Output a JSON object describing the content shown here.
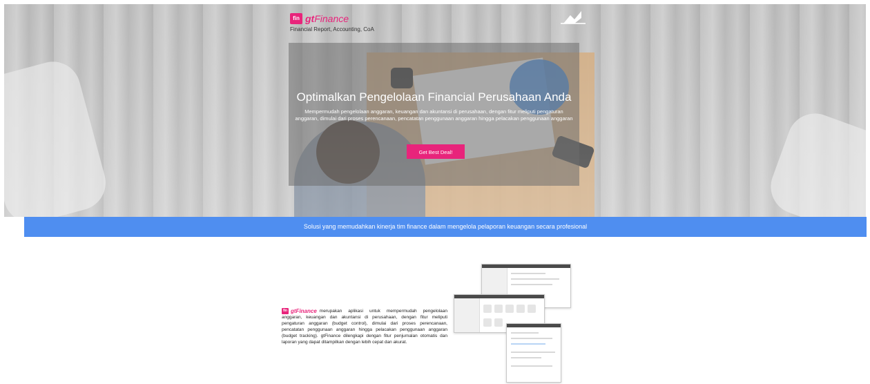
{
  "brand": {
    "logo_mark": "fin",
    "name_gt": "gt",
    "name_finance": "Finance",
    "tagline": "Financial Report, Accounting, CoA"
  },
  "hero": {
    "title": "Optimalkan Pengelolaan Financial Perusahaan Anda",
    "description": "Mempermudah pengelolaan anggaran, keuangan dan akuntansi di perusahaan, dengan fitur meliputi pengaturan anggaran, dimulai dari proses perencanaan, pencatatan penggunaan anggaran hingga pelacakan penggunaan anggaran",
    "cta_label": "Get Best Deal!"
  },
  "band": {
    "text": "Solusi yang memudahkan kinerja tim finance dalam mengelola pelaporan keuangan secara profesional"
  },
  "about": {
    "logo_mark": "fin",
    "name": "gtFinance",
    "text": "merupakan aplikasi untuk mempermudah pengelolaan anggaran, keuangan dan akuntansi di perusahaan, dengan fitur meliputi pengaturan anggaran (budget control), dimulai dari proses perencanaan, pencatatan penggunaan anggaran hingga pelacakan penggunaan anggaran (budget tracking). gtFinance dilengkapi dengan fitur penjurnalan otomatis dan laporan yang dapat ditampilkan dengan lebih cepat dan akurat."
  },
  "colors": {
    "accent": "#e8247b",
    "band": "#4f8ef0"
  },
  "icons": {
    "partner_logo": "partner-logo-icon"
  }
}
